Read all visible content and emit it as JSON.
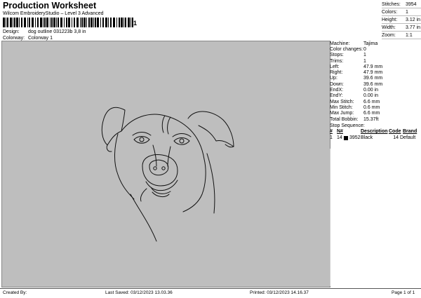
{
  "header": {
    "title": "Production Worksheet",
    "subtitle": "Wilcom EmbroideryStudio – Level 3 Advanced",
    "barcode_digit": "1"
  },
  "info": {
    "design_label": "Design:",
    "design_value": "dog outline 031223b 3,8 in",
    "colorway_label": "Colorway:",
    "colorway_value": "Colorway 1"
  },
  "stats": [
    {
      "label": "Stitches:",
      "value": "3954"
    },
    {
      "label": "Colors:",
      "value": "1"
    },
    {
      "label": "Height:",
      "value": "3.12 in"
    },
    {
      "label": "Width:",
      "value": "3.77 in"
    },
    {
      "label": "Zoom:",
      "value": "1:1"
    }
  ],
  "machine_info": [
    {
      "label": "Machine:",
      "value": "Tajima"
    },
    {
      "label": "Color changes:",
      "value": "0"
    },
    {
      "label": "Stops:",
      "value": "1"
    },
    {
      "label": "Trims:",
      "value": "1"
    },
    {
      "label": "Left:",
      "value": "47.9 mm"
    },
    {
      "label": "Right:",
      "value": "47.9 mm"
    },
    {
      "label": "Up:",
      "value": "39.6 mm"
    },
    {
      "label": "Down:",
      "value": "39.6 mm"
    },
    {
      "label": "EndX:",
      "value": "0.00 in"
    },
    {
      "label": "EndY:",
      "value": "0.00 in"
    },
    {
      "label": "Max Stitch:",
      "value": "6.6 mm"
    },
    {
      "label": "Min Stitch:",
      "value": "0.6 mm"
    },
    {
      "label": "Max Jump:",
      "value": "6.6 mm"
    },
    {
      "label": "Total Bobbin:",
      "value": "15.37ft"
    }
  ],
  "stop_sequence": {
    "title": "Stop Sequence:",
    "columns": [
      "#",
      "N#",
      "Description",
      "Code",
      "Brand"
    ],
    "rows": [
      {
        "num": "1",
        "needle": "14",
        "stitches": "3952",
        "description": "Black",
        "code": "14",
        "brand": "Default"
      }
    ],
    "swatch_color": "#000000"
  },
  "footer": {
    "created": "Created By:",
    "last_saved": "Last Saved: 03/12/2023 13.03.36",
    "printed": "Printed: 03/12/2023 14.16.37",
    "page": "Page 1 of 1"
  },
  "colors": {
    "canvas_bg": "#bebebe",
    "thread": "#111111"
  }
}
